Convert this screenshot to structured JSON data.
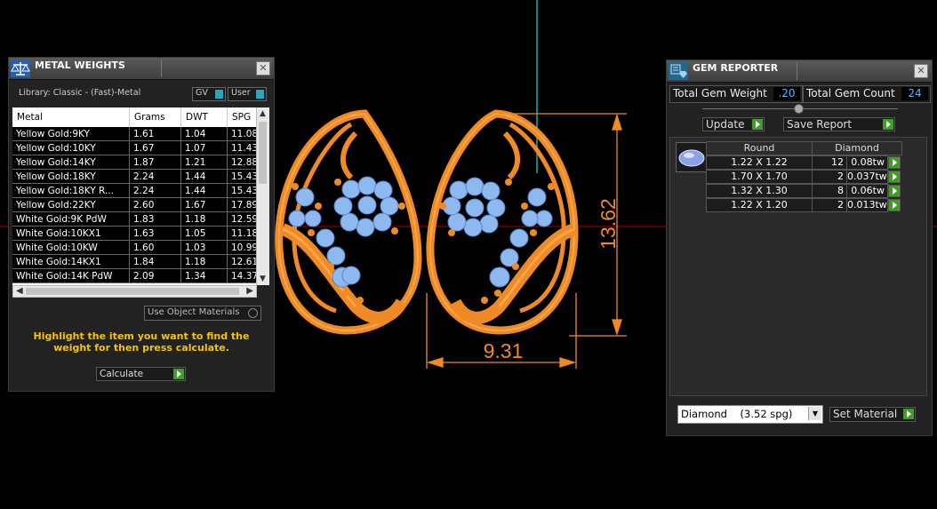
{
  "metal_weights": {
    "title": "METAL WEIGHTS",
    "library_label": "Library: Classic - (Fast)-Metal",
    "gv_label": "GV",
    "user_label": "User",
    "columns": [
      "Metal",
      "Grams",
      "DWT",
      "SPG"
    ],
    "rows": [
      {
        "metal": "Yellow Gold:9KY",
        "grams": "1.61",
        "dwt": "1.04",
        "spg": "11.08"
      },
      {
        "metal": "Yellow Gold:10KY",
        "grams": "1.67",
        "dwt": "1.07",
        "spg": "11.43"
      },
      {
        "metal": "Yellow Gold:14KY",
        "grams": "1.87",
        "dwt": "1.21",
        "spg": "12.88"
      },
      {
        "metal": "Yellow Gold:18KY",
        "grams": "2.24",
        "dwt": "1.44",
        "spg": "15.43"
      },
      {
        "metal": "Yellow Gold:18KY R...",
        "grams": "2.24",
        "dwt": "1.44",
        "spg": "15.43"
      },
      {
        "metal": "Yellow Gold:22KY",
        "grams": "2.60",
        "dwt": "1.67",
        "spg": "17.89"
      },
      {
        "metal": "White Gold:9K PdW",
        "grams": "1.83",
        "dwt": "1.18",
        "spg": "12.59"
      },
      {
        "metal": "White Gold:10KX1",
        "grams": "1.63",
        "dwt": "1.05",
        "spg": "11.18"
      },
      {
        "metal": "White Gold:10KW",
        "grams": "1.60",
        "dwt": "1.03",
        "spg": "10.99"
      },
      {
        "metal": "White Gold:14KX1",
        "grams": "1.84",
        "dwt": "1.18",
        "spg": "12.61"
      },
      {
        "metal": "White Gold:14K PdW",
        "grams": "2.09",
        "dwt": "1.34",
        "spg": "14.37"
      }
    ],
    "use_object_materials": "Use Object Materials",
    "instruction": "Highlight the item you want to find the weight for then press calculate.",
    "calculate_label": "Calculate"
  },
  "gem_reporter": {
    "title": "GEM REPORTER",
    "total_weight_label": "Total Gem Weight",
    "total_weight_value": ".20",
    "total_count_label": "Total Gem Count",
    "total_count_value": "24",
    "update_label": "Update",
    "save_report_label": "Save Report",
    "shape_header": "Round",
    "material_header": "Diamond",
    "gems": [
      {
        "size": "1.22 X 1.22",
        "count": "12",
        "weight": "0.08tw"
      },
      {
        "size": "1.70 X 1.70",
        "count": "2",
        "weight": "0.037tw"
      },
      {
        "size": "1.32 X 1.30",
        "count": "8",
        "weight": "0.06tw"
      },
      {
        "size": "1.22 X 1.20",
        "count": "2",
        "weight": "0.013tw"
      }
    ],
    "material_select": "Diamond    (3.52 spg)",
    "set_material_label": "Set Material"
  },
  "viewport": {
    "width_dimension": "9.31",
    "height_dimension": "13.62"
  },
  "colors": {
    "metal": "#f08a24",
    "gem": "#8db8f0",
    "dimension": "#f08a24",
    "axis_red": "#b00000",
    "axis_cyan": "#2aa6b8",
    "instruction_text": "#f5c400"
  }
}
